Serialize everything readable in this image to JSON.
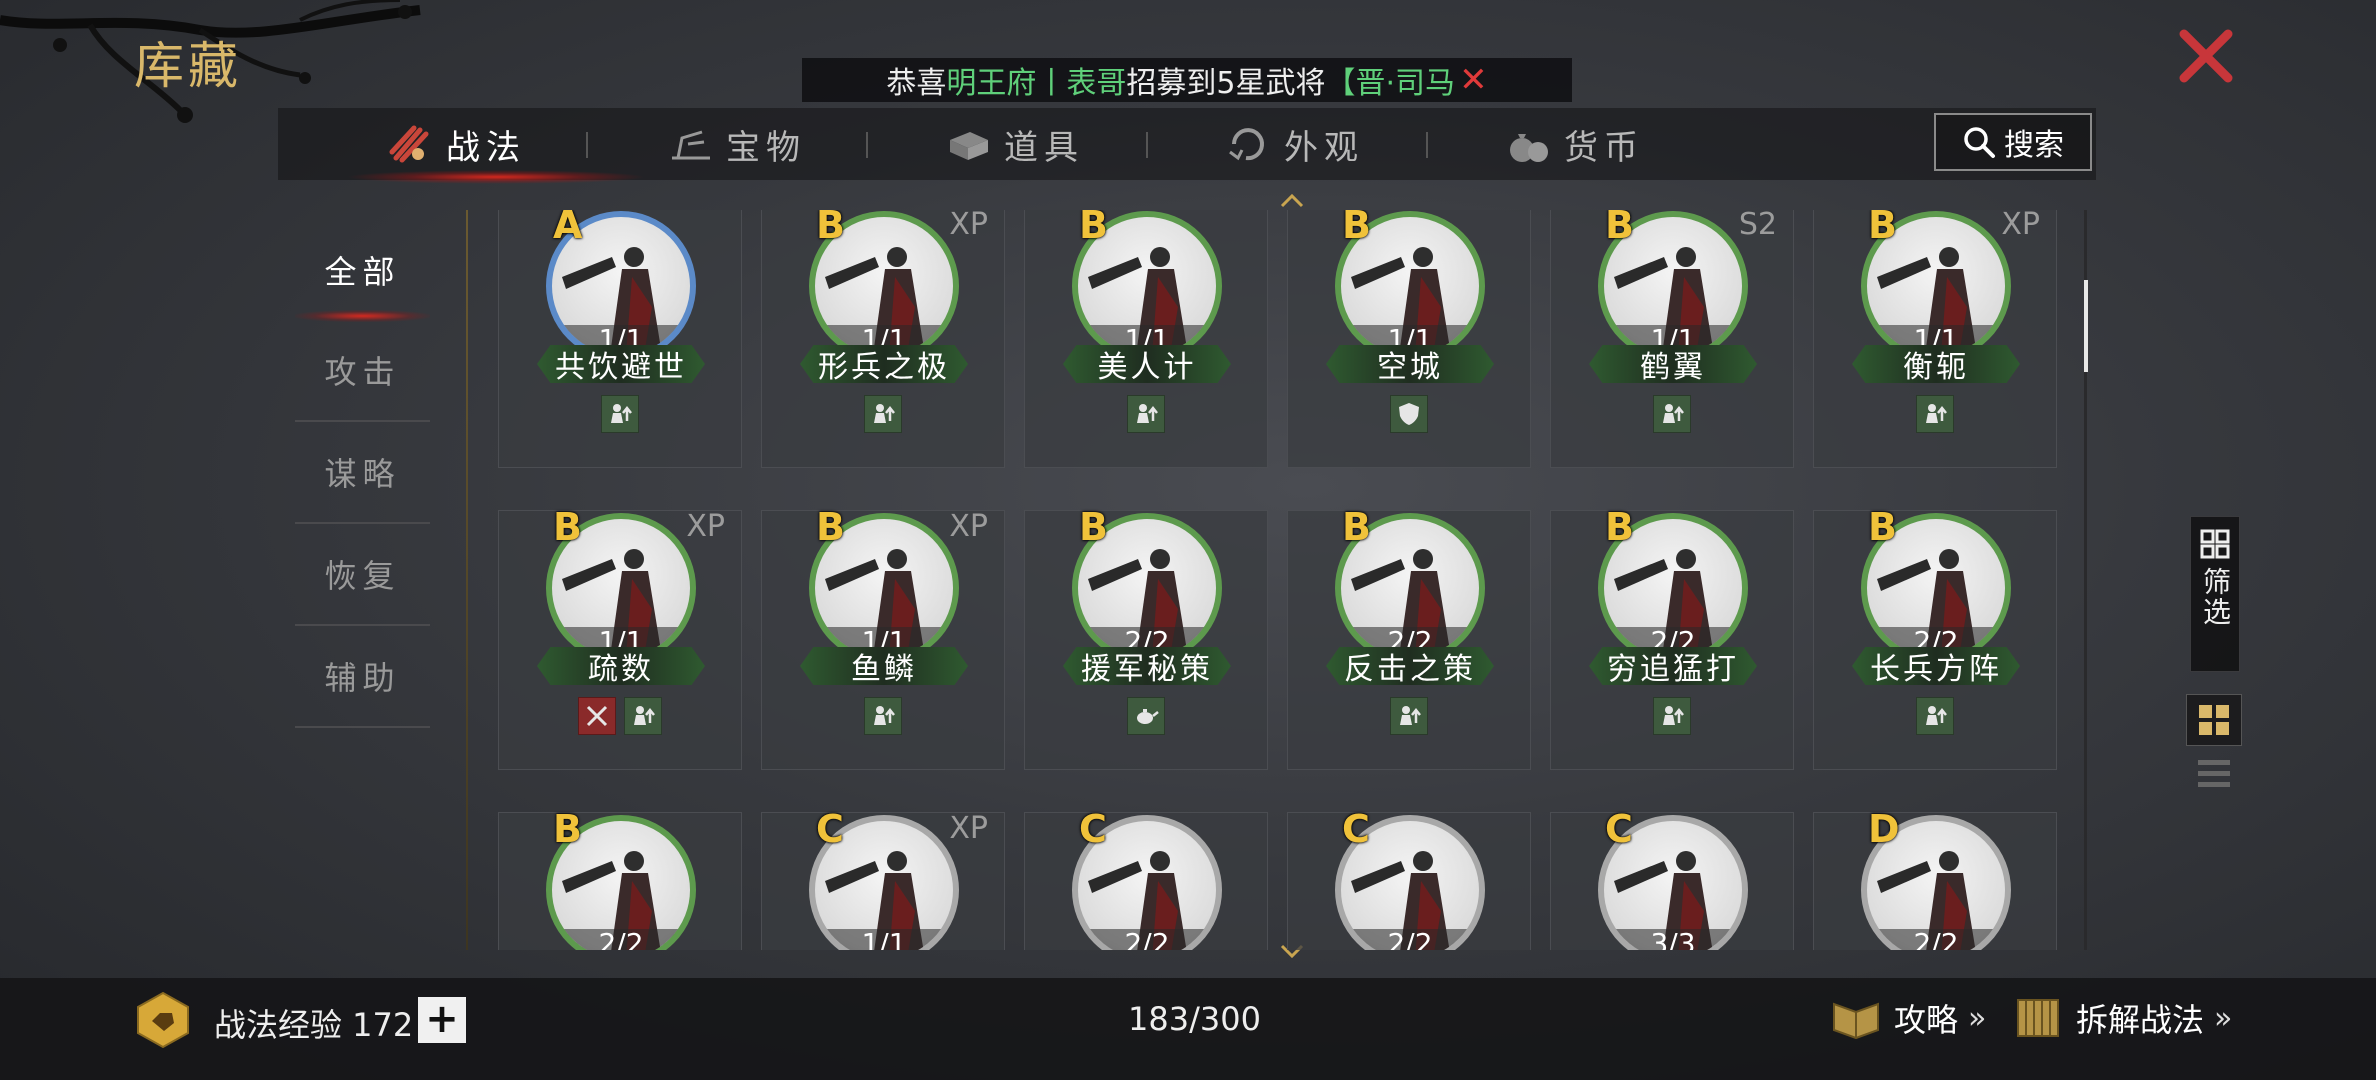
{
  "page": {
    "title": "库藏"
  },
  "ticker": {
    "prefix": "恭喜",
    "guild": "明王府",
    "sep": "丨",
    "player": "表哥",
    "middle": "招募到5星武将",
    "general": "【晋·司马",
    "close": "✕"
  },
  "tabs": [
    {
      "label": "战法",
      "icon": "scroll-bundle-icon",
      "active": true
    },
    {
      "label": "宝物",
      "icon": "treasure-icon",
      "active": false
    },
    {
      "label": "道具",
      "icon": "item-icon",
      "active": false
    },
    {
      "label": "外观",
      "icon": "appearance-icon",
      "active": false
    },
    {
      "label": "货币",
      "icon": "money-bag-icon",
      "active": false
    }
  ],
  "search": {
    "label": "搜索"
  },
  "categories": [
    "全部",
    "攻击",
    "谋略",
    "恢复",
    "辅助"
  ],
  "cards": [
    {
      "grade": "A",
      "tag": "",
      "count": "1/1",
      "name": "共饮避世",
      "ring": "#5b8ac8",
      "icons": [
        "troop-up-icon"
      ]
    },
    {
      "grade": "B",
      "tag": "XP",
      "count": "1/1",
      "name": "形兵之极",
      "ring": "#5d9a4d",
      "icons": [
        "troop-up-icon"
      ]
    },
    {
      "grade": "B",
      "tag": "",
      "count": "1/1",
      "name": "美人计",
      "ring": "#5d9a4d",
      "icons": [
        "troop-up-icon"
      ]
    },
    {
      "grade": "B",
      "tag": "",
      "count": "1/1",
      "name": "空城",
      "ring": "#5d9a4d",
      "icons": [
        "shield-icon"
      ]
    },
    {
      "grade": "B",
      "tag": "S2",
      "count": "1/1",
      "name": "鹤翼",
      "ring": "#5d9a4d",
      "icons": [
        "troop-up-icon"
      ]
    },
    {
      "grade": "B",
      "tag": "XP",
      "count": "1/1",
      "name": "衡轭",
      "ring": "#5d9a4d",
      "icons": [
        "troop-up-icon"
      ]
    },
    {
      "grade": "B",
      "tag": "XP",
      "count": "1/1",
      "name": "疏数",
      "ring": "#5d9a4d",
      "icons": [
        "crossed-swords-icon",
        "troop-up-icon"
      ]
    },
    {
      "grade": "B",
      "tag": "XP",
      "count": "1/1",
      "name": "鱼鳞",
      "ring": "#5d9a4d",
      "icons": [
        "troop-up-icon"
      ]
    },
    {
      "grade": "B",
      "tag": "",
      "count": "2/2",
      "name": "援军秘策",
      "ring": "#5d9a4d",
      "icons": [
        "teapot-icon"
      ]
    },
    {
      "grade": "B",
      "tag": "",
      "count": "2/2",
      "name": "反击之策",
      "ring": "#5d9a4d",
      "icons": [
        "troop-up-icon"
      ]
    },
    {
      "grade": "B",
      "tag": "",
      "count": "2/2",
      "name": "穷追猛打",
      "ring": "#5d9a4d",
      "icons": [
        "troop-up-icon"
      ]
    },
    {
      "grade": "B",
      "tag": "",
      "count": "2/2",
      "name": "长兵方阵",
      "ring": "#5d9a4d",
      "icons": [
        "troop-up-icon"
      ]
    },
    {
      "grade": "B",
      "tag": "",
      "count": "2/2",
      "name": "",
      "ring": "#5d9a4d",
      "icons": []
    },
    {
      "grade": "C",
      "tag": "XP",
      "count": "1/1",
      "name": "",
      "ring": "#a8a8a8",
      "icons": []
    },
    {
      "grade": "C",
      "tag": "",
      "count": "2/2",
      "name": "",
      "ring": "#a8a8a8",
      "icons": []
    },
    {
      "grade": "C",
      "tag": "",
      "count": "2/2",
      "name": "",
      "ring": "#a8a8a8",
      "icons": []
    },
    {
      "grade": "C",
      "tag": "",
      "count": "3/3",
      "name": "",
      "ring": "#a8a8a8",
      "icons": []
    },
    {
      "grade": "D",
      "tag": "",
      "count": "2/2",
      "name": "",
      "ring": "#a8a8a8",
      "icons": []
    }
  ],
  "side": {
    "filter_label": "筛选"
  },
  "bottom": {
    "exp_label": "战法经验 172",
    "plus": "+",
    "page_count": "183/300",
    "strategy_label": "攻略",
    "dismantle_label": "拆解战法",
    "chevron": "»"
  },
  "colors": {
    "accent_gold": "#d9b86a",
    "grade_gold": "#f0c23a",
    "close_red": "#c8363a",
    "highlight_green": "#5fd07a"
  }
}
